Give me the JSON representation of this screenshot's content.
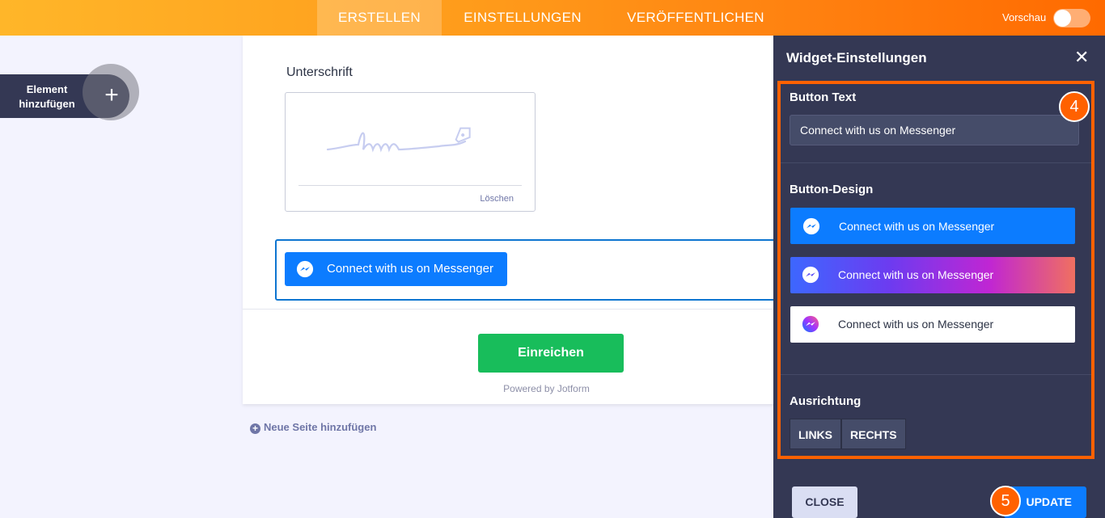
{
  "topbar": {
    "tabs": [
      {
        "label": "ERSTELLEN",
        "active": true
      },
      {
        "label": "EINSTELLUNGEN",
        "active": false
      },
      {
        "label": "VERÖFFENTLICHEN",
        "active": false
      }
    ],
    "preview_label": "Vorschau",
    "preview_on": false
  },
  "sidebar": {
    "add_element_label_1": "Element",
    "add_element_label_2": "hinzufügen",
    "add_icon": "plus-icon"
  },
  "form": {
    "signature_label": "Unterschrift",
    "signature_clear": "Löschen",
    "messenger_button_text": "Connect with us on Messenger",
    "submit_label": "Einreichen",
    "powered_by": "Powered by Jotform",
    "new_page_label": "Neue Seite hinzufügen"
  },
  "panel": {
    "title": "Widget-Einstellungen",
    "close_icon": "close-icon",
    "button_text_label": "Button Text",
    "button_text_value": "Connect with us on Messenger",
    "button_design_label": "Button-Design",
    "design_options": [
      {
        "label": "Connect with us on Messenger",
        "style": "blue"
      },
      {
        "label": "Connect with us on Messenger",
        "style": "gradient"
      },
      {
        "label": "Connect with us on Messenger",
        "style": "white"
      }
    ],
    "alignment_label": "Ausrichtung",
    "alignment_options": [
      "LINKS",
      "RECHTS"
    ],
    "close_label": "CLOSE",
    "update_label": "UPDATE",
    "step_badges": [
      "4",
      "5"
    ]
  },
  "colors": {
    "accent_orange": "#ff6100",
    "messenger_blue": "#0c7cff",
    "submit_green": "#18bd5b",
    "panel_bg": "#343854"
  }
}
